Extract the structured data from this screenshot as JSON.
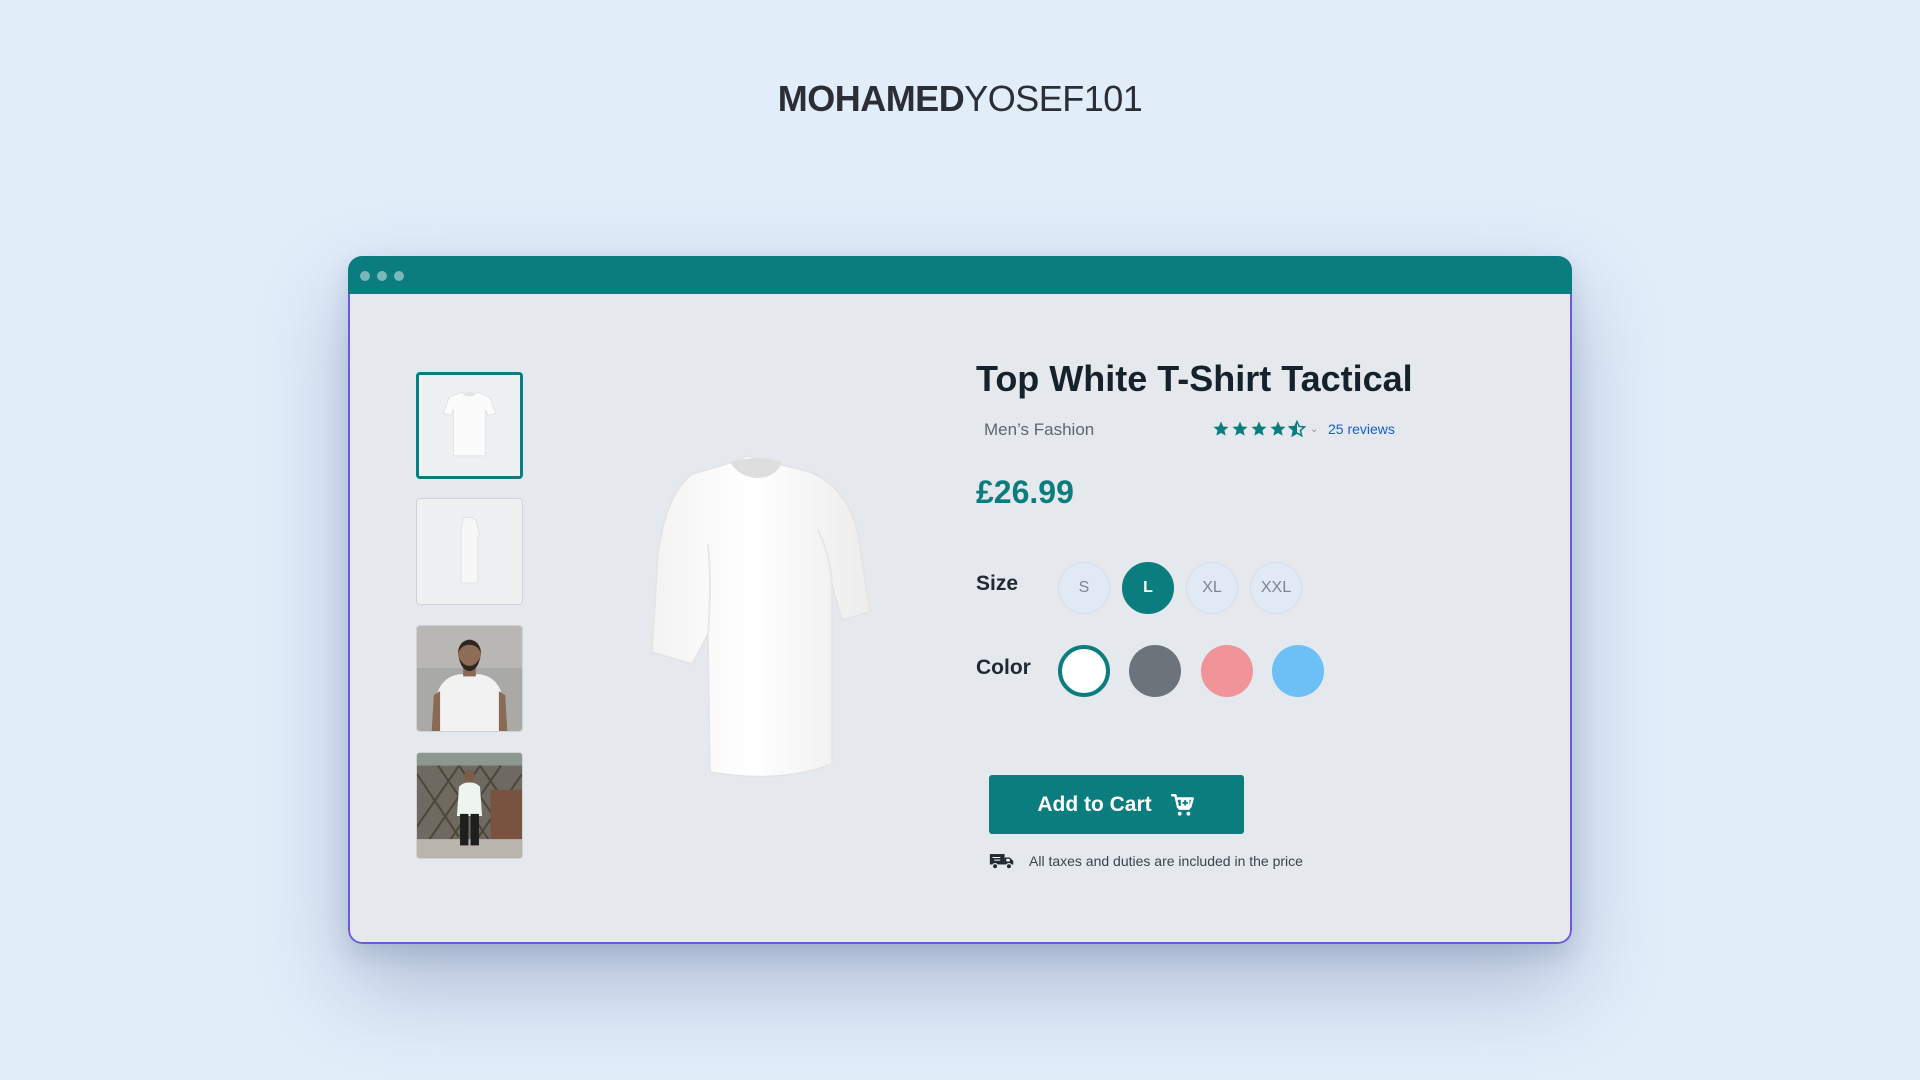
{
  "brand": {
    "bold": "MOHAMED",
    "light": "YOSEF101"
  },
  "product": {
    "title": "Top White T-Shirt Tactical",
    "category": "Men’s Fashion",
    "rating": 4.5,
    "rating_max": 5,
    "reviews_label": "25 reviews",
    "price": "£26.99"
  },
  "size": {
    "label": "Size",
    "options": [
      "S",
      "L",
      "XL",
      "XXL"
    ],
    "selected": "L"
  },
  "color": {
    "label": "Color",
    "options": [
      "#ffffff",
      "#6c737b",
      "#f0949a",
      "#6cc0f5"
    ],
    "selected": "#ffffff"
  },
  "cart": {
    "label": "Add to Cart",
    "icon": "cart-plus-icon"
  },
  "shipping": {
    "text": "All taxes and duties are included in the price",
    "icon": "delivery-truck-icon"
  },
  "thumbnails": [
    "tshirt-front",
    "tshirt-side",
    "model-front",
    "model-full-body"
  ],
  "accent": "#0b7d7e"
}
